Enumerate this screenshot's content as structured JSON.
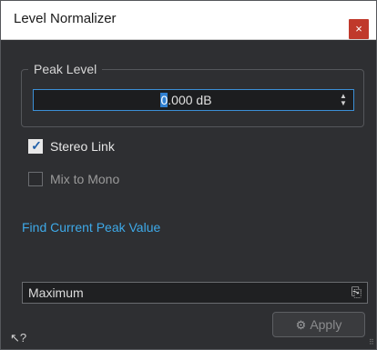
{
  "window": {
    "title": "Level Normalizer",
    "close_glyph": "×"
  },
  "peak_group": {
    "legend": "Peak Level",
    "value_selected_part": "0",
    "value_rest": ".000 dB"
  },
  "options": {
    "stereo_link": {
      "label": "Stereo Link",
      "checked": true,
      "color": "#e6e6e6"
    },
    "mix_to_mono": {
      "label": "Mix to Mono",
      "checked": false,
      "color": "#9a9a9a"
    }
  },
  "find_peak_link": "Find Current Peak Value",
  "preset": {
    "value": "Maximum"
  },
  "apply_button": {
    "label": "Apply",
    "icon": "gears-icon"
  },
  "icons": [
    "close-icon",
    "spin-arrows-icon",
    "check-icon",
    "presets-icon",
    "gears-icon",
    "help-pointer-icon",
    "resize-grip-icon"
  ],
  "colors": {
    "accent": "#3b8fd6",
    "link": "#3ea9e8",
    "close": "#c0392b",
    "background": "#2e2f32"
  }
}
